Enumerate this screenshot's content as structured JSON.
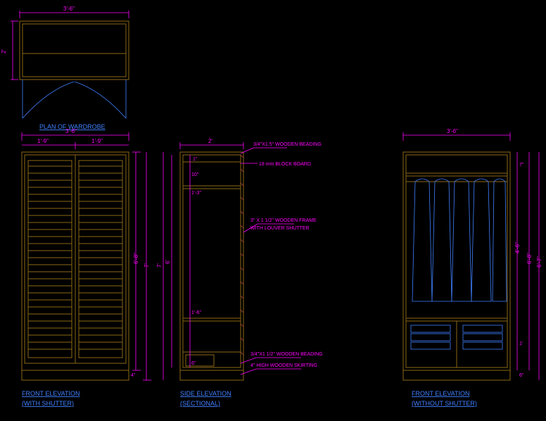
{
  "plan": {
    "title": "PLAN OF WARDROBE",
    "width": "3'-6\"",
    "depth": "2'"
  },
  "front_shutter": {
    "title_l1": "FRONT ELEVATION",
    "title_l2": "(WITH SHUTTER)",
    "width": "3'-6\"",
    "half_l": "1'-9\"",
    "half_r": "1'-9\"",
    "height": "6'-8\"",
    "overall_h": "7'",
    "skirting": "4\""
  },
  "side": {
    "title_l1": "SIDE ELEVATION",
    "title_l2": "(SECTIONAL)",
    "width": "2'",
    "height": "6'",
    "overall_h": "7'",
    "top_gap": "1\"",
    "shelf1": "10\"",
    "shelf1b": "1'-3\"",
    "bottom_shelf": "1'-6\"",
    "skirting": "6\"",
    "note_beading_top": "3/4\"X1.5\" WOODEN BEADING",
    "note_block": "18 mm BLOCK BOARD",
    "note_frame_l1": "3\" X 1 1/2\" WOODEN FRAME",
    "note_frame_l2": "WITH LOUVER SHUTTER",
    "note_beading_bot": "3/4\"X1 1/2\" WOODEN BEADING",
    "note_skirt": "4\" HIGH WOODEN SKIRTING"
  },
  "front_no_shutter": {
    "title_l1": "FRONT ELEVATION",
    "title_l2": "(WITHOUT SHUTTER)",
    "width": "3'-6\"",
    "height": "6'-8\"",
    "overall_h": "6'-7\"",
    "top": "7\"",
    "hang": "4'-6\"",
    "shelf": "1'",
    "skirting": "6\""
  }
}
